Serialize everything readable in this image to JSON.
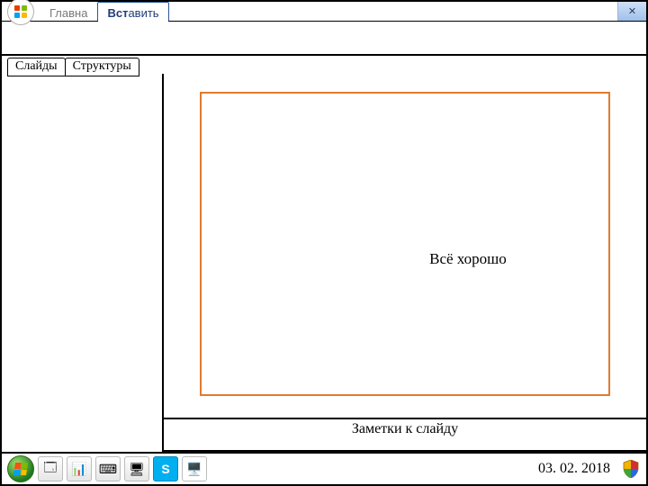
{
  "ribbon": {
    "home_label": "Главна",
    "insert_label_prefix": "Вст",
    "insert_label_suffix": "авить"
  },
  "side_tabs": {
    "slides": "Слайды",
    "outline": "Структуры"
  },
  "slide": {
    "placeholder_text": "Всё хорошо"
  },
  "notes": {
    "label": "Заметки к слайду"
  },
  "taskbar": {
    "date": "03. 02. 2018"
  },
  "icons": {
    "start": "start-menu-icon",
    "explorer": "explorer-icon",
    "chart": "chart-icon",
    "keyboard": "keyboard-icon",
    "devices": "devices-icon",
    "skype": "skype-icon",
    "desktop": "desktop-icon",
    "shield": "security-shield-icon",
    "close": "window-close-icon",
    "office": "office-button-icon"
  }
}
